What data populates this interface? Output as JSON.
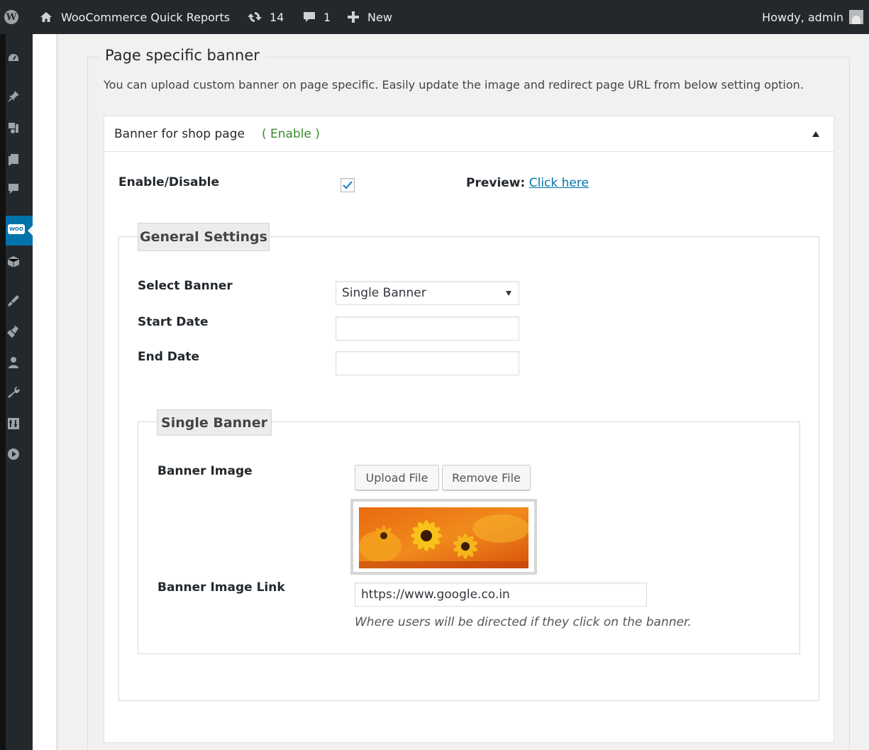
{
  "adminbar": {
    "site_name": "WooCommerce Quick Reports",
    "updates_count": "14",
    "comments_count": "1",
    "new_label": "New",
    "howdy": "Howdy, admin"
  },
  "adminmenu": {
    "icons": [
      "dashboard-icon",
      "posts-pin-icon",
      "media-icon",
      "pages-icon",
      "comments-icon",
      "woocommerce-icon",
      "products-icon",
      "appearance-icon",
      "plugins-icon",
      "users-icon",
      "tools-icon",
      "settings-icon",
      "media-play-icon"
    ],
    "woo_badge": "WOO"
  },
  "section": {
    "title": "Page specific banner",
    "intro": "You can upload custom banner on page specific. Easily update the image and redirect page URL from below setting option."
  },
  "panel": {
    "title": "Banner for shop page",
    "status": "( Enable )",
    "enable_label": "Enable/Disable",
    "enable_checked": true,
    "preview_label": "Preview:",
    "preview_link": "Click here"
  },
  "general_settings": {
    "legend": "General Settings",
    "select_banner_label": "Select Banner",
    "select_banner_value": "Single Banner",
    "start_date_label": "Start Date",
    "start_date_value": "",
    "end_date_label": "End Date",
    "end_date_value": ""
  },
  "single_banner": {
    "legend": "Single Banner",
    "image_label": "Banner Image",
    "upload_button": "Upload File",
    "remove_button": "Remove File",
    "link_label": "Banner Image Link",
    "link_value": "https://www.google.co.in",
    "link_hint": "Where users will be directed if they click on the banner."
  },
  "colors": {
    "adminbar_bg": "#23282d",
    "accent": "#0073aa",
    "enable_status": "#3a8a2c"
  }
}
